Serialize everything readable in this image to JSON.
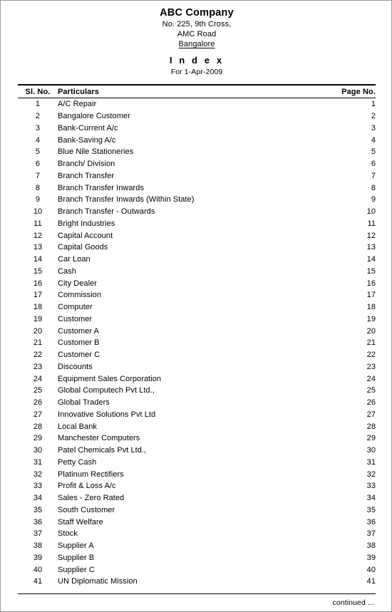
{
  "document": {
    "company_name": "ABC Company",
    "address_line1": "No. 225, 9th Cross,",
    "address_line2": "AMC Road",
    "city": "Bangalore",
    "title": "I n d e x",
    "period": "For 1-Apr-2009"
  },
  "table": {
    "headers": {
      "sl_no": "Sl. No.",
      "particulars": "Particulars",
      "page_no": "Page No."
    },
    "rows": [
      {
        "sl_no": "1",
        "particulars": "A/C Repair",
        "page_no": "1"
      },
      {
        "sl_no": "2",
        "particulars": "Bangalore Customer",
        "page_no": "2"
      },
      {
        "sl_no": "3",
        "particulars": "Bank-Current A/c",
        "page_no": "3"
      },
      {
        "sl_no": "4",
        "particulars": "Bank-Saving A/c",
        "page_no": "4"
      },
      {
        "sl_no": "5",
        "particulars": "Blue Nile Stationeries",
        "page_no": "5"
      },
      {
        "sl_no": "6",
        "particulars": "Branch/ Division",
        "page_no": "6"
      },
      {
        "sl_no": "7",
        "particulars": "Branch Transfer",
        "page_no": "7"
      },
      {
        "sl_no": "8",
        "particulars": "Branch Transfer Inwards",
        "page_no": "8"
      },
      {
        "sl_no": "9",
        "particulars": "Branch Transfer Inwards (Within State)",
        "page_no": "9"
      },
      {
        "sl_no": "10",
        "particulars": "Branch Transfer - Outwards",
        "page_no": "10"
      },
      {
        "sl_no": "11",
        "particulars": "Bright Industries",
        "page_no": "11"
      },
      {
        "sl_no": "12",
        "particulars": "Capital Account",
        "page_no": "12"
      },
      {
        "sl_no": "13",
        "particulars": "Capital Goods",
        "page_no": "13"
      },
      {
        "sl_no": "14",
        "particulars": "Car Loan",
        "page_no": "14"
      },
      {
        "sl_no": "15",
        "particulars": "Cash",
        "page_no": "15"
      },
      {
        "sl_no": "16",
        "particulars": "City Dealer",
        "page_no": "16"
      },
      {
        "sl_no": "17",
        "particulars": "Commission",
        "page_no": "17"
      },
      {
        "sl_no": "18",
        "particulars": "Computer",
        "page_no": "18"
      },
      {
        "sl_no": "19",
        "particulars": "Customer",
        "page_no": "19"
      },
      {
        "sl_no": "20",
        "particulars": "Customer A",
        "page_no": "20"
      },
      {
        "sl_no": "21",
        "particulars": "Customer B",
        "page_no": "21"
      },
      {
        "sl_no": "22",
        "particulars": "Customer C",
        "page_no": "22"
      },
      {
        "sl_no": "23",
        "particulars": "Discounts",
        "page_no": "23"
      },
      {
        "sl_no": "24",
        "particulars": "Equipment Sales Corporation",
        "page_no": "24"
      },
      {
        "sl_no": "25",
        "particulars": "Global Computech Pvt Ltd.,",
        "page_no": "25"
      },
      {
        "sl_no": "26",
        "particulars": "Global Traders",
        "page_no": "26"
      },
      {
        "sl_no": "27",
        "particulars": "Innovative Solutions Pvt Ltd",
        "page_no": "27"
      },
      {
        "sl_no": "28",
        "particulars": "Local Bank",
        "page_no": "28"
      },
      {
        "sl_no": "29",
        "particulars": "Manchester Computers",
        "page_no": "29"
      },
      {
        "sl_no": "30",
        "particulars": "Patel Chemicals Pvt Ltd.,",
        "page_no": "30"
      },
      {
        "sl_no": "31",
        "particulars": "Petty Cash",
        "page_no": "31"
      },
      {
        "sl_no": "32",
        "particulars": "Platinum Rectifiers",
        "page_no": "32"
      },
      {
        "sl_no": "33",
        "particulars": "Profit & Loss A/c",
        "page_no": "33"
      },
      {
        "sl_no": "34",
        "particulars": "Sales - Zero Rated",
        "page_no": "34"
      },
      {
        "sl_no": "35",
        "particulars": "South Customer",
        "page_no": "35"
      },
      {
        "sl_no": "36",
        "particulars": "Staff Welfare",
        "page_no": "36"
      },
      {
        "sl_no": "37",
        "particulars": "Stock",
        "page_no": "37"
      },
      {
        "sl_no": "38",
        "particulars": "Supplier A",
        "page_no": "38"
      },
      {
        "sl_no": "39",
        "particulars": "Supplier B",
        "page_no": "39"
      },
      {
        "sl_no": "40",
        "particulars": "Supplier C",
        "page_no": "40"
      },
      {
        "sl_no": "41",
        "particulars": "UN Diplomatic Mission",
        "page_no": "41"
      }
    ]
  },
  "footer": {
    "continued_label": "continued ..."
  }
}
